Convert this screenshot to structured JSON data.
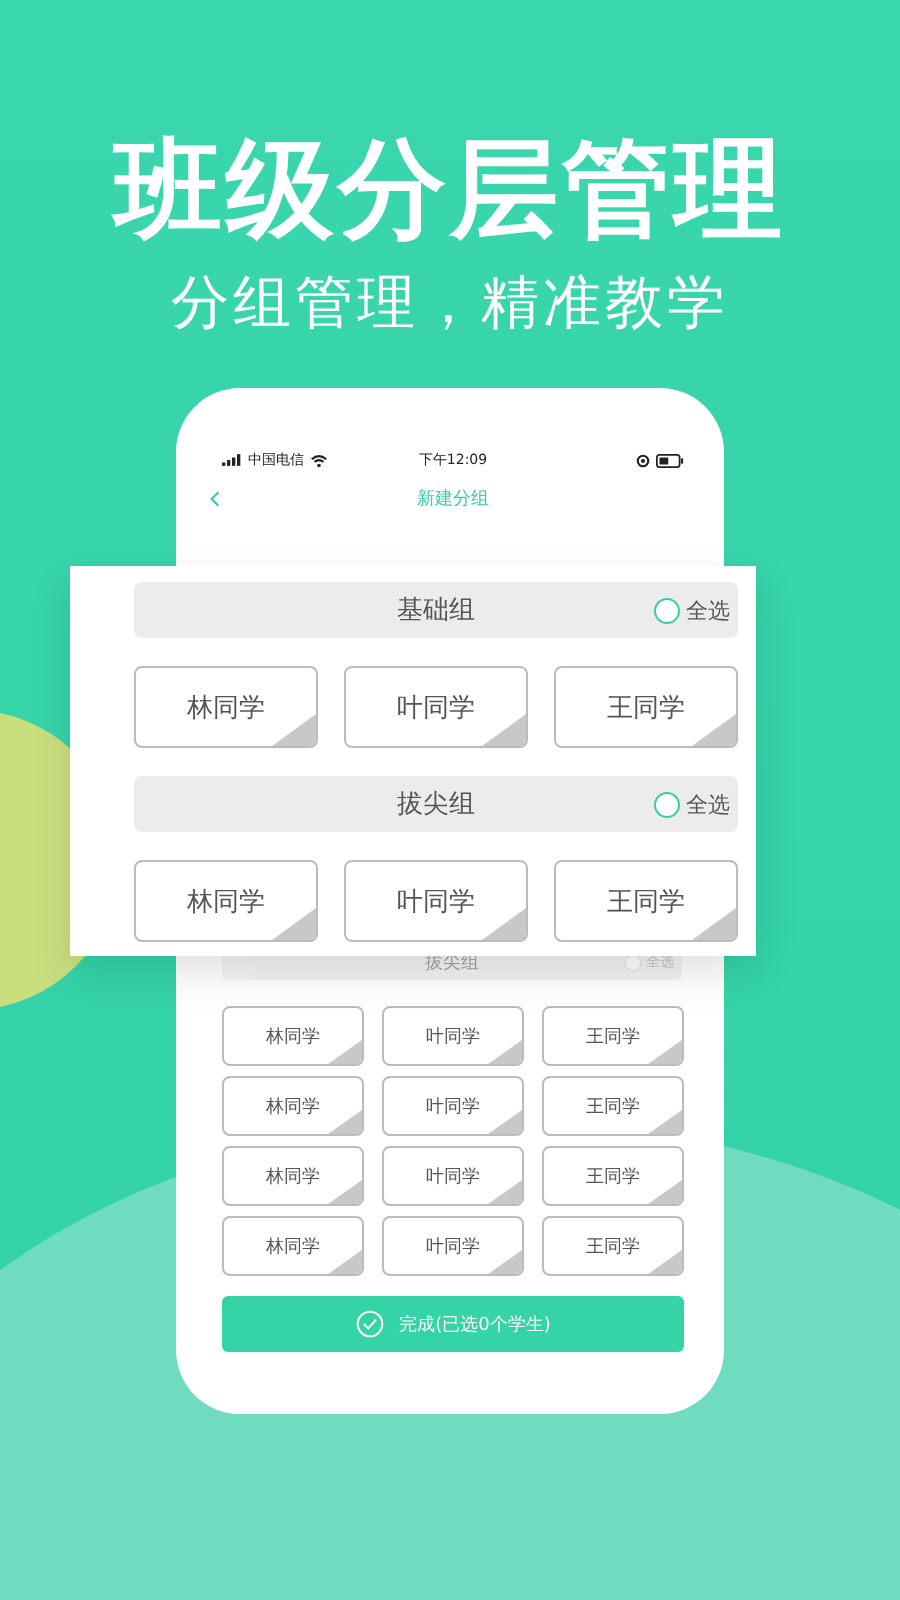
{
  "headline": "班级分层管理",
  "subtitle": "分组管理，精准教学",
  "phone": {
    "status_bar": {
      "carrier": "中国电信",
      "time": "下午12:09"
    },
    "nav": {
      "title": "新建分组"
    },
    "group": {
      "name": "拔尖组",
      "select_all": "全选",
      "checked": false,
      "students": [
        {
          "name": "林同学",
          "selected": false
        },
        {
          "name": "叶同学",
          "selected": false
        },
        {
          "name": "王同学",
          "selected": false
        },
        {
          "name": "林同学",
          "selected": false
        },
        {
          "name": "叶同学",
          "selected": false
        },
        {
          "name": "王同学",
          "selected": false
        },
        {
          "name": "林同学",
          "selected": false
        },
        {
          "name": "叶同学",
          "selected": false
        },
        {
          "name": "王同学",
          "selected": false
        },
        {
          "name": "林同学",
          "selected": false
        },
        {
          "name": "叶同学",
          "selected": false
        },
        {
          "name": "王同学",
          "selected": false
        }
      ]
    },
    "done_button": "完成(已选0个学生)"
  },
  "popup": {
    "groups": [
      {
        "name": "基础组",
        "select_all": "全选",
        "checked": false,
        "students": [
          {
            "name": "林同学",
            "selected": false
          },
          {
            "name": "叶同学",
            "selected": false
          },
          {
            "name": "王同学",
            "selected": false
          }
        ]
      },
      {
        "name": "拔尖组",
        "select_all": "全选",
        "checked": false,
        "students": [
          {
            "name": "林同学",
            "selected": false
          },
          {
            "name": "叶同学",
            "selected": false
          },
          {
            "name": "王同学",
            "selected": false
          }
        ]
      }
    ]
  }
}
